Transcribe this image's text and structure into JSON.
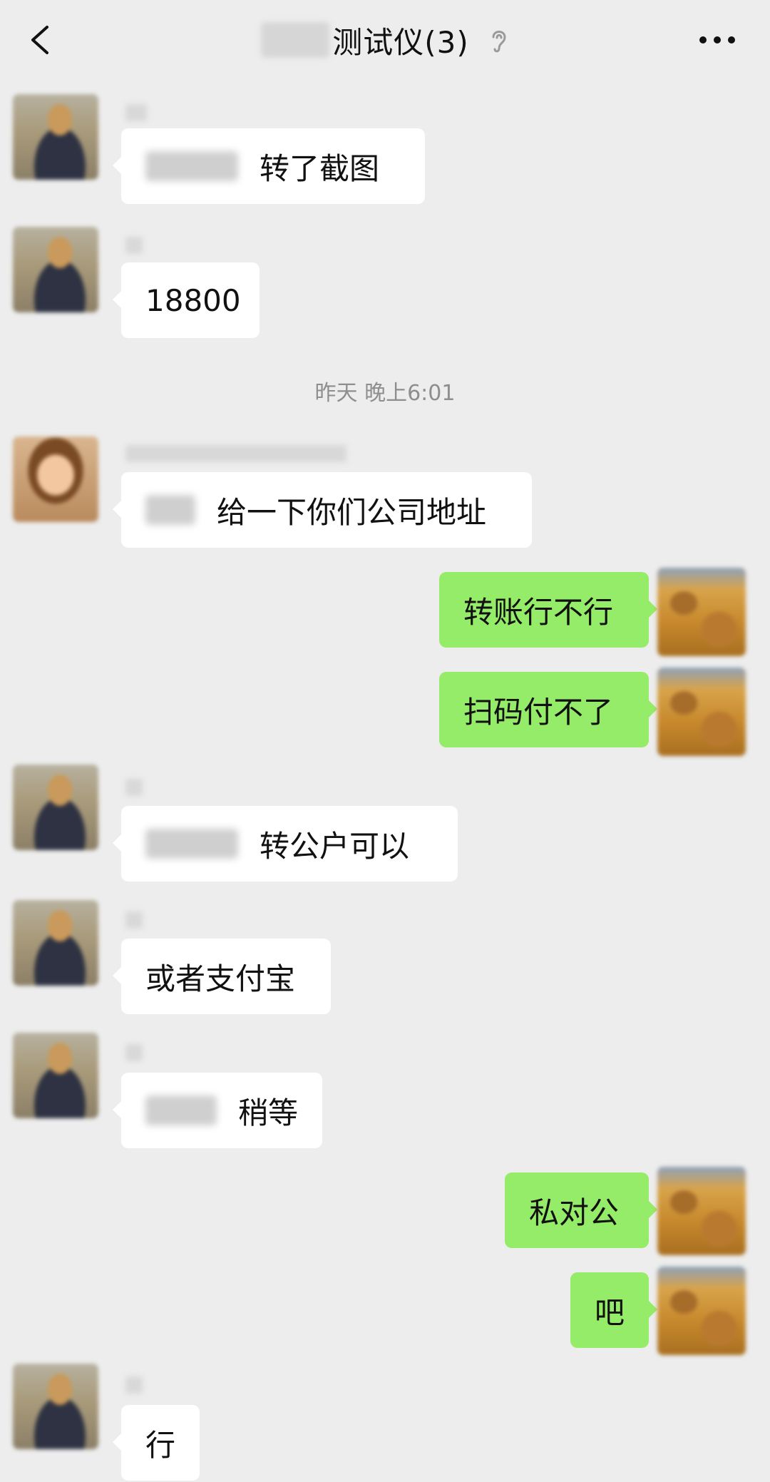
{
  "header": {
    "title": "测试仪(3)",
    "back_icon": "chevron-left-icon",
    "ear_icon": "ear-icon",
    "more_icon": "more-icon"
  },
  "colors": {
    "background": "#ededed",
    "bubble_incoming": "#ffffff",
    "bubble_outgoing": "#95ec69"
  },
  "messages": [
    {
      "side": "left",
      "text": "转了截图",
      "has_mention": true
    },
    {
      "side": "left",
      "text": "18800",
      "has_mention": false
    },
    {
      "side": "left",
      "text": "给一下你们公司地址",
      "has_mention": true
    },
    {
      "side": "right",
      "text": "转账行不行"
    },
    {
      "side": "right",
      "text": "扫码付不了"
    },
    {
      "side": "left",
      "text": "转公户可以",
      "has_mention": true
    },
    {
      "side": "left",
      "text": "或者支付宝",
      "has_mention": false
    },
    {
      "side": "left",
      "text": "稍等",
      "has_mention": true
    },
    {
      "side": "right",
      "text": "私对公"
    },
    {
      "side": "right",
      "text": "吧"
    },
    {
      "side": "left",
      "text": "行",
      "has_mention": false
    }
  ],
  "timestamp": "昨天 晚上6:01"
}
